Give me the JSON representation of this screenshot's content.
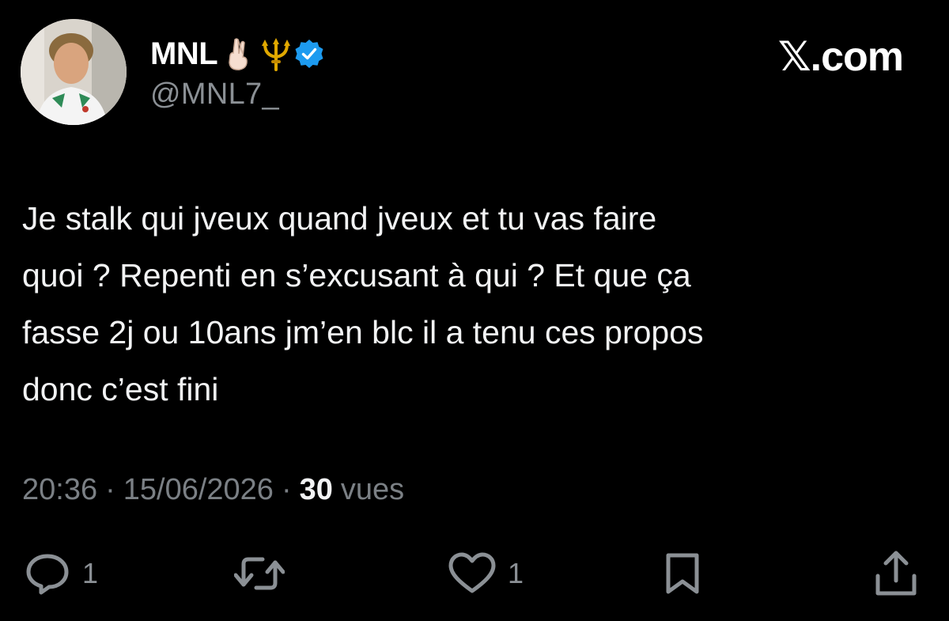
{
  "tweet": {
    "author": {
      "display_name": "MNL",
      "emojis": [
        "crossed-fingers",
        "trident"
      ],
      "verified": true,
      "handle": "@MNL7_"
    },
    "brand": "𝕏.com",
    "text": "Je stalk qui jveux quand jveux et tu vas faire\nquoi ? Repenti en s’excusant à qui ? Et que ça\nfasse 2j ou 10ans jm’en blc il a tenu ces propos\ndonc c’est fini",
    "meta": {
      "time": "20:36",
      "separator_1": "·",
      "date": "15/06/2026",
      "separator_2": "·",
      "views_count": "30",
      "views_label": "vues"
    },
    "actions": {
      "reply_count": "1",
      "like_count": "1"
    }
  },
  "colors": {
    "background": "#000000",
    "text": "#f2f3f4",
    "muted": "#8b9095",
    "verified": "#1d9bf0"
  }
}
